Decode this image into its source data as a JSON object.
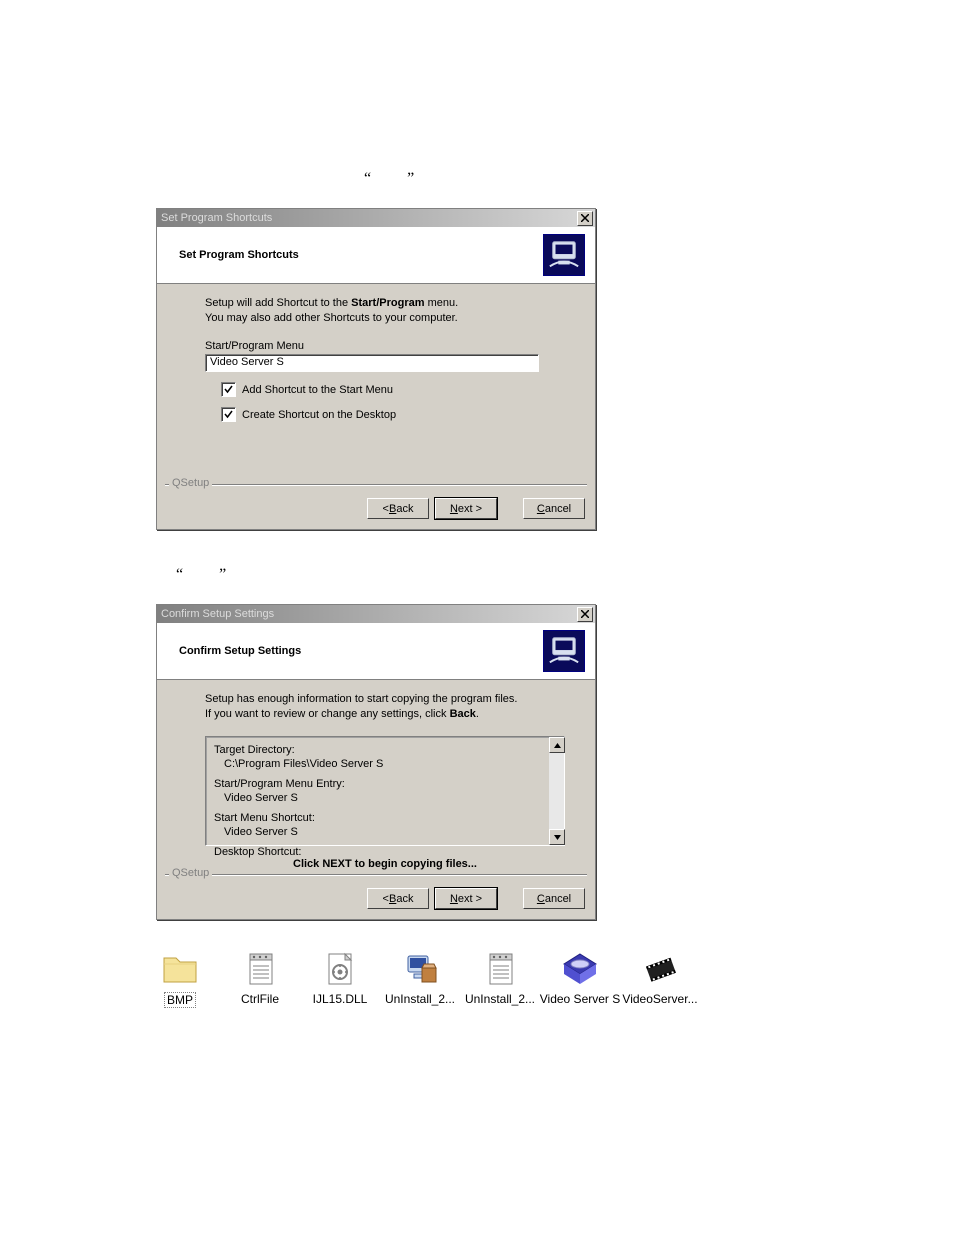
{
  "doc": {
    "line1_quote_open": "“",
    "line1_quote_close": "”",
    "line2_quote_open": "“",
    "line2_quote_close": "”"
  },
  "dialog1": {
    "title": "Set Program Shortcuts",
    "header": "Set Program Shortcuts",
    "intro_part1": "Setup will add Shortcut to the ",
    "intro_bold": "Start/Program",
    "intro_part2": " menu.",
    "intro_line2": "You may also add other Shortcuts to your computer.",
    "field_label": "Start/Program Menu",
    "field_value": "Video Server S",
    "checkbox1_label": "Add Shortcut to the Start Menu",
    "checkbox1_checked": true,
    "checkbox2_label": "Create Shortcut on the Desktop",
    "checkbox2_checked": true,
    "groupbox": "QSetup",
    "back_prefix": "< ",
    "back_mn": "B",
    "back_suffix": "ack",
    "next_mn": "N",
    "next_suffix": "ext >",
    "cancel_mn": "C",
    "cancel_suffix": "ancel"
  },
  "dialog2": {
    "title": "Confirm Setup Settings",
    "header": "Confirm Setup Settings",
    "intro_line1": "Setup has enough information to start copying the program files.",
    "intro_line2_pre": "If you want to review or change any settings, click ",
    "intro_line2_bold": "Back",
    "intro_line2_post": ".",
    "entry1_title": "Target Directory:",
    "entry1_value": "C:\\Program Files\\Video Server S",
    "entry2_title": "Start/Program Menu Entry:",
    "entry2_value": "Video Server S",
    "entry3_title": "Start Menu Shortcut:",
    "entry3_value": "Video Server S",
    "entry4_title": "Desktop Shortcut:",
    "instruction": "Click NEXT to begin copying files...",
    "groupbox": "QSetup",
    "back_prefix": "< ",
    "back_mn": "B",
    "back_suffix": "ack",
    "next_mn": "N",
    "next_suffix": "ext >",
    "cancel_mn": "C",
    "cancel_suffix": "ancel"
  },
  "files": {
    "f1": "BMP",
    "f2": "CtrlFile",
    "f3": "IJL15.DLL",
    "f4": "UnInstall_2...",
    "f5": "UnInstall_2...",
    "f6": "Video Server S",
    "f7": "VideoServer..."
  }
}
